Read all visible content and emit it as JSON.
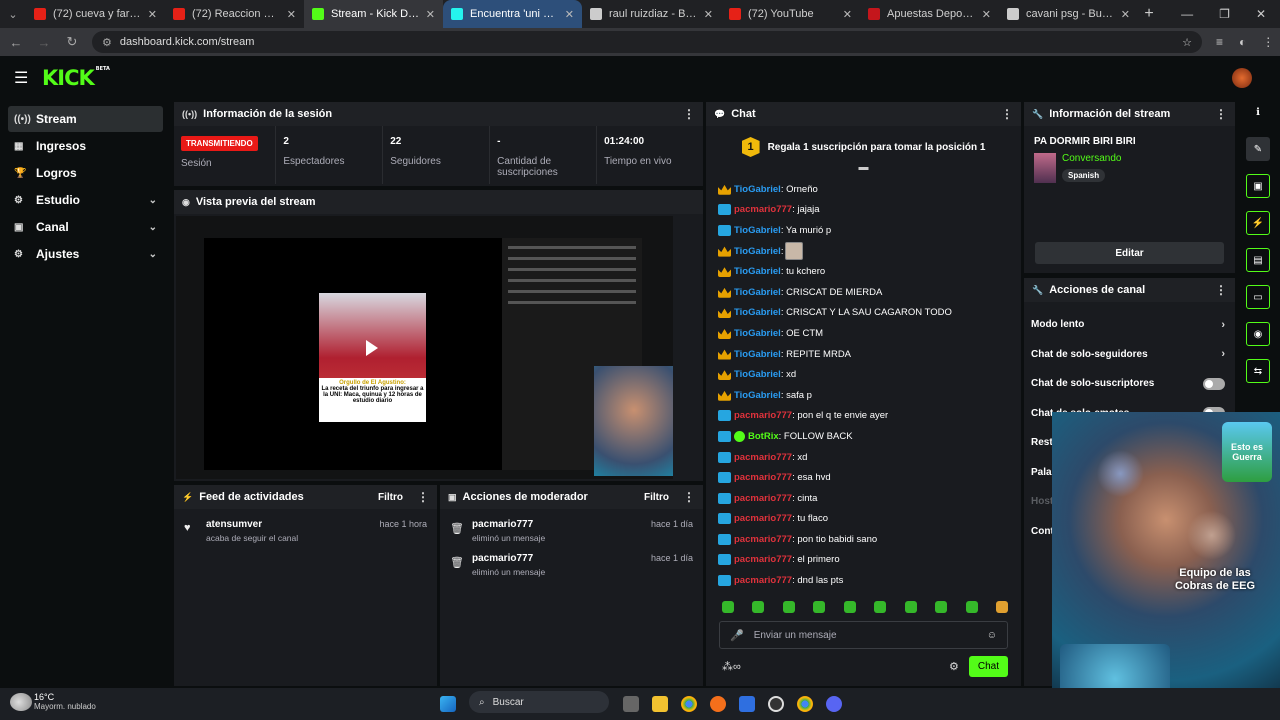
{
  "browser": {
    "tabs": [
      {
        "title": "(72) cueva y farfan penale",
        "icon_color": "#e62117",
        "state": "normal"
      },
      {
        "title": "(72) Reaccion U Católica l",
        "icon_color": "#e62117",
        "state": "normal"
      },
      {
        "title": "Stream - Kick Dashboard",
        "icon_color": "#53fc18",
        "state": "active"
      },
      {
        "title": "Encuentra 'uni 2do puest",
        "icon_color": "#25f4ee",
        "state": "hover"
      },
      {
        "title": "raul ruizdiaz - Buscar con",
        "icon_color": "#cccccc",
        "state": "normal"
      },
      {
        "title": "(72) YouTube",
        "icon_color": "#e62117",
        "state": "normal"
      },
      {
        "title": "Apuestas Deportivas Onli",
        "icon_color": "#c4161c",
        "state": "normal"
      },
      {
        "title": "cavani psg - Buscar con G",
        "icon_color": "#cccccc",
        "state": "normal"
      }
    ],
    "url": "dashboard.kick.com/stream"
  },
  "logo": "KICK",
  "logo_badge": "BETA",
  "sidebar": {
    "items": [
      {
        "label": "Stream",
        "icon": "broadcast-icon",
        "active": true
      },
      {
        "label": "Ingresos",
        "icon": "ingresos-icon"
      },
      {
        "label": "Logros",
        "icon": "trophy-icon"
      },
      {
        "label": "Estudio",
        "icon": "studio-icon",
        "expandable": true
      },
      {
        "label": "Canal",
        "icon": "channel-icon",
        "expandable": true
      },
      {
        "label": "Ajustes",
        "icon": "gear-icon",
        "expandable": true
      }
    ]
  },
  "session": {
    "title": "Información de la sesión",
    "live_badge": "TRANSMITIENDO",
    "session_label": "Sesión",
    "stats": [
      {
        "value": "2",
        "label": "Espectadores"
      },
      {
        "value": "22",
        "label": "Seguidores"
      },
      {
        "value": "-",
        "label": "Cantidad de suscripciones"
      },
      {
        "value": "01:24:00",
        "label": "Tiempo en vivo"
      }
    ]
  },
  "preview": {
    "title": "Vista previa del stream",
    "caption_title": "Orgullo de El Agustino:",
    "caption_body": "La receta del triunfo para ingresar a la UNI: Maca, quinua y 12 horas de estudio diario"
  },
  "activity_feed": {
    "title": "Feed de actividades",
    "filter_label": "Filtro",
    "items": [
      {
        "user": "atensumver",
        "action": "acaba de seguir el canal",
        "time": "hace 1 hora"
      }
    ]
  },
  "mod_actions": {
    "title": "Acciones de moderador",
    "filter_label": "Filtro",
    "items": [
      {
        "user": "pacmario777",
        "action": "eliminó un mensaje",
        "time": "hace 1 día"
      },
      {
        "user": "pacmario777",
        "action": "eliminó un mensaje",
        "time": "hace 1 día"
      }
    ]
  },
  "chat": {
    "title": "Chat",
    "gift_badge": "1",
    "gift_text": "Regala 1 suscripción para tomar la posición 1",
    "pin_icon": "chevron-lines-icon",
    "messages": [
      {
        "user": "TioGabriel",
        "text": ": Orneño",
        "badge": "crown",
        "color": "u1"
      },
      {
        "user": "pacmario777",
        "text": ": jajaja",
        "badge": "mod",
        "color": "u2"
      },
      {
        "user": "TioGabriel",
        "text": ": Ya murió p",
        "badge": "mod",
        "color": "u1"
      },
      {
        "user": "TioGabriel",
        "text": ":",
        "badge": "crown",
        "color": "u1",
        "emote": true
      },
      {
        "user": "TioGabriel",
        "text": ": tu kchero",
        "badge": "crown",
        "color": "u1"
      },
      {
        "user": "TioGabriel",
        "text": ": CRISCAT DE MIERDA",
        "badge": "crown",
        "color": "u1"
      },
      {
        "user": "TioGabriel",
        "text": ": CRISCAT Y LA SAU CAGARON TODO",
        "badge": "crown",
        "color": "u1"
      },
      {
        "user": "TioGabriel",
        "text": ": OE CTM",
        "badge": "crown",
        "color": "u1"
      },
      {
        "user": "TioGabriel",
        "text": ": REPITE MRDA",
        "badge": "crown",
        "color": "u1"
      },
      {
        "user": "TioGabriel",
        "text": ": xd",
        "badge": "crown",
        "color": "u1"
      },
      {
        "user": "TioGabriel",
        "text": ": safa p",
        "badge": "crown",
        "color": "u1"
      },
      {
        "user": "pacmario777",
        "text": ": pon el q te envie ayer",
        "badge": "mod",
        "color": "u2"
      },
      {
        "user": "BotRix",
        "text": ": FOLLOW BACK",
        "badge": "bot",
        "color": "u3"
      },
      {
        "user": "pacmario777",
        "text": ": xd",
        "badge": "mod",
        "color": "u2"
      },
      {
        "user": "pacmario777",
        "text": ": esa hvd",
        "badge": "mod",
        "color": "u2"
      },
      {
        "user": "pacmario777",
        "text": ": cinta",
        "badge": "mod",
        "color": "u2"
      },
      {
        "user": "pacmario777",
        "text": ": tu flaco",
        "badge": "mod",
        "color": "u2"
      },
      {
        "user": "pacmario777",
        "text": ": pon tio babidi sano",
        "badge": "mod",
        "color": "u2"
      },
      {
        "user": "pacmario777",
        "text": ": el primero",
        "badge": "mod",
        "color": "u2"
      },
      {
        "user": "pacmario777",
        "text": ": dnd las pts",
        "badge": "mod",
        "color": "u2"
      }
    ],
    "input_placeholder": "Enviar un mensaje",
    "send_label": "Chat"
  },
  "stream_info": {
    "title": "Información del stream",
    "stream_title": "PA DORMIR BIRI BIRI",
    "category": "Conversando",
    "language": "Spanish",
    "edit_label": "Editar"
  },
  "channel_actions": {
    "title": "Acciones de canal",
    "items": [
      {
        "label": "Modo lento",
        "kind": "chevron"
      },
      {
        "label": "Chat de solo-seguidores",
        "kind": "chevron"
      },
      {
        "label": "Chat de solo-suscriptores",
        "kind": "toggle"
      },
      {
        "label": "Chat de solo-emotes",
        "kind": "toggle"
      },
      {
        "label": "Rest",
        "kind": "none"
      },
      {
        "label": "Pala",
        "kind": "none"
      },
      {
        "label": "Host",
        "kind": "dim"
      },
      {
        "label": "Cont",
        "kind": "none"
      }
    ]
  },
  "overlay": {
    "logo_text": "Esto es Guerra",
    "caption": "Equipo de las Cobras de EEG",
    "badge_text": "Equipo de las Cobras de EEG"
  },
  "taskbar": {
    "temperature": "16°C",
    "condition": "Mayorm. nublado",
    "search_label": "Buscar"
  }
}
